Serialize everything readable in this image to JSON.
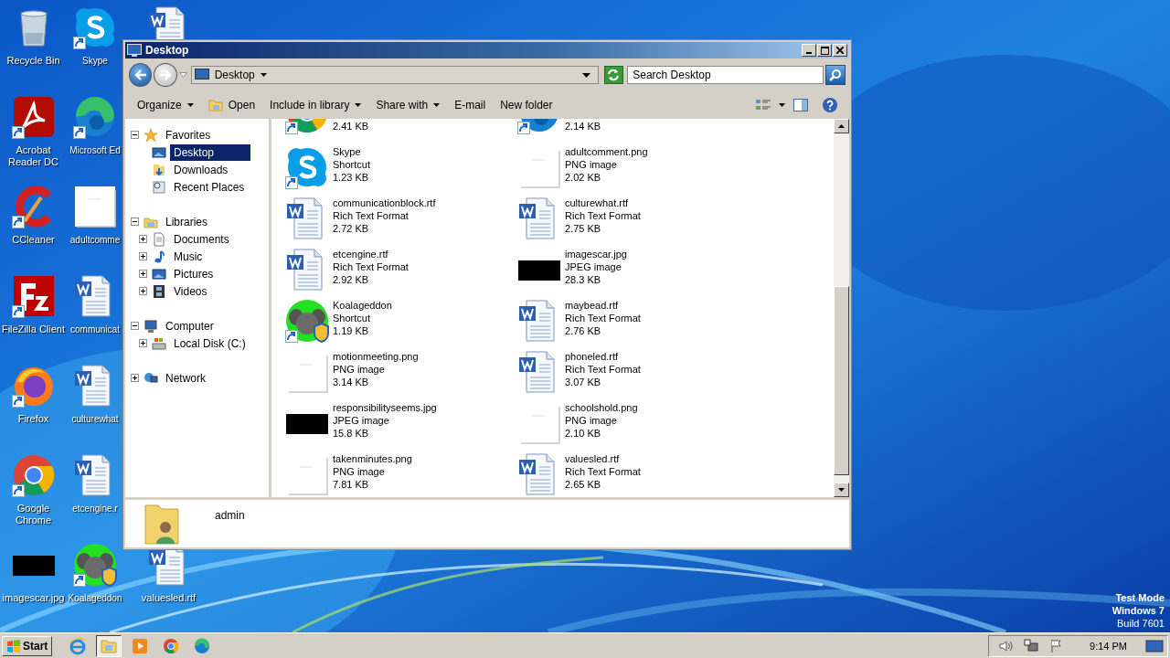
{
  "desktop": {
    "columns": [
      {
        "icons": [
          {
            "label": "Recycle Bin",
            "kind": "recycle",
            "shortcut": false
          },
          {
            "label": "Acrobat Reader DC",
            "kind": "acrobat",
            "shortcut": true
          },
          {
            "label": "CCleaner",
            "kind": "ccleaner",
            "shortcut": true
          },
          {
            "label": "FileZilla Client",
            "kind": "filezilla",
            "shortcut": true
          },
          {
            "label": "Firefox",
            "kind": "firefox",
            "shortcut": true
          },
          {
            "label": "Google Chrome",
            "kind": "chrome",
            "shortcut": true
          },
          {
            "label": "imagescar.jpg",
            "kind": "jpg",
            "shortcut": false
          }
        ]
      },
      {
        "icons": [
          {
            "label": "Skype",
            "kind": "skype",
            "shortcut": true
          },
          {
            "label": "Microsoft Ed",
            "kind": "edge",
            "shortcut": true
          },
          {
            "label": "adultcomme",
            "kind": "png",
            "shortcut": false
          },
          {
            "label": "communicat",
            "kind": "rtf",
            "shortcut": false
          },
          {
            "label": "culturewhat",
            "kind": "rtf",
            "shortcut": false
          },
          {
            "label": "etcengine.r",
            "kind": "rtf",
            "shortcut": false
          },
          {
            "label": "Koalageddon",
            "kind": "koala",
            "shortcut": true
          }
        ]
      },
      {
        "icons": [
          {
            "kind": "rtf",
            "shortcut": false
          },
          {
            "label": "valuesled.rtf",
            "kind": "rtf",
            "shortcut": false
          }
        ]
      }
    ],
    "os_notice": [
      "Test Mode",
      "Windows 7",
      "Build 7601"
    ]
  },
  "window": {
    "title": "Desktop",
    "address": "Desktop",
    "search": {
      "placeholder": "Search Desktop"
    },
    "toolbar": [
      {
        "label": "Organize",
        "kind": "menu"
      },
      {
        "label": "Open",
        "kind": "open"
      },
      {
        "label": "Include in library",
        "kind": "menu"
      },
      {
        "label": "Share with",
        "kind": "menu"
      },
      {
        "label": "E-mail",
        "kind": "plain"
      },
      {
        "label": "New folder",
        "kind": "plain"
      }
    ],
    "navigation": [
      {
        "label": "Favorites",
        "kind": "star",
        "expanded": true,
        "selected": false,
        "children": [
          {
            "label": "Desktop",
            "kind": "desktop",
            "selected": true
          },
          {
            "label": "Downloads",
            "kind": "downloads",
            "selected": false
          },
          {
            "label": "Recent Places",
            "kind": "recent",
            "selected": false
          }
        ]
      },
      {
        "label": "Libraries",
        "kind": "library",
        "expanded": true,
        "selected": false,
        "children": [
          {
            "label": "Documents",
            "kind": "documents",
            "expanded": false,
            "selected": false
          },
          {
            "label": "Music",
            "kind": "music",
            "expanded": false,
            "selected": false
          },
          {
            "label": "Pictures",
            "kind": "pictures",
            "expanded": false,
            "selected": false
          },
          {
            "label": "Videos",
            "kind": "videos",
            "expanded": false,
            "selected": false
          }
        ]
      },
      {
        "label": "Computer",
        "kind": "computer",
        "expanded": true,
        "selected": false,
        "children": [
          {
            "label": "Local Disk (C:)",
            "kind": "disk",
            "expanded": false,
            "selected": false
          }
        ]
      },
      {
        "label": "Network",
        "kind": "network",
        "expanded": false,
        "selected": false
      }
    ],
    "files": [
      {
        "size": "2.41 KB",
        "kind": "chrome",
        "shortcut": true
      },
      {
        "size": "2.14 KB",
        "kind": "edge",
        "shortcut": true
      },
      {
        "name": "Skype",
        "type": "Shortcut",
        "size": "1.23 KB",
        "kind": "skype",
        "shortcut": true
      },
      {
        "name": "adultcomment.png",
        "type": "PNG image",
        "size": "2.02 KB",
        "kind": "png",
        "shortcut": false
      },
      {
        "name": "communicationblock.rtf",
        "type": "Rich Text Format",
        "size": "2.72 KB",
        "kind": "rtf",
        "shortcut": false
      },
      {
        "name": "culturewhat.rtf",
        "type": "Rich Text Format",
        "size": "2.75 KB",
        "kind": "rtf",
        "shortcut": false
      },
      {
        "name": "etcengine.rtf",
        "type": "Rich Text Format",
        "size": "2.92 KB",
        "kind": "rtf",
        "shortcut": false
      },
      {
        "name": "imagescar.jpg",
        "type": "JPEG image",
        "size": "28.3 KB",
        "kind": "jpg",
        "shortcut": false
      },
      {
        "name": "Koalageddon",
        "type": "Shortcut",
        "size": "1.19 KB",
        "kind": "koala",
        "shortcut": true
      },
      {
        "name": "maybead.rtf",
        "type": "Rich Text Format",
        "size": "2.76 KB",
        "kind": "rtf",
        "shortcut": false
      },
      {
        "name": "motionmeeting.png",
        "type": "PNG image",
        "size": "3.14 KB",
        "kind": "png",
        "shortcut": false
      },
      {
        "name": "phoneled.rtf",
        "type": "Rich Text Format",
        "size": "3.07 KB",
        "kind": "rtf",
        "shortcut": false
      },
      {
        "name": "responsibilityseems.jpg",
        "type": "JPEG image",
        "size": "15.8 KB",
        "kind": "jpg",
        "shortcut": false
      },
      {
        "name": "schoolshold.png",
        "type": "PNG image",
        "size": "2.10 KB",
        "kind": "png",
        "shortcut": false
      },
      {
        "name": "takenminutes.png",
        "type": "PNG image",
        "size": "7.81 KB",
        "kind": "png",
        "shortcut": false
      },
      {
        "name": "valuesled.rtf",
        "type": "Rich Text Format",
        "size": "2.65 KB",
        "kind": "rtf",
        "shortcut": false
      }
    ],
    "details": {
      "name": "admin"
    }
  },
  "taskbar": {
    "start": "Start",
    "apps": [
      {
        "kind": "ie",
        "active": false
      },
      {
        "kind": "explorer",
        "active": true
      },
      {
        "kind": "media",
        "active": false
      },
      {
        "kind": "chrome",
        "active": false
      },
      {
        "kind": "edge",
        "active": false
      }
    ],
    "clock": "9:14 PM"
  }
}
